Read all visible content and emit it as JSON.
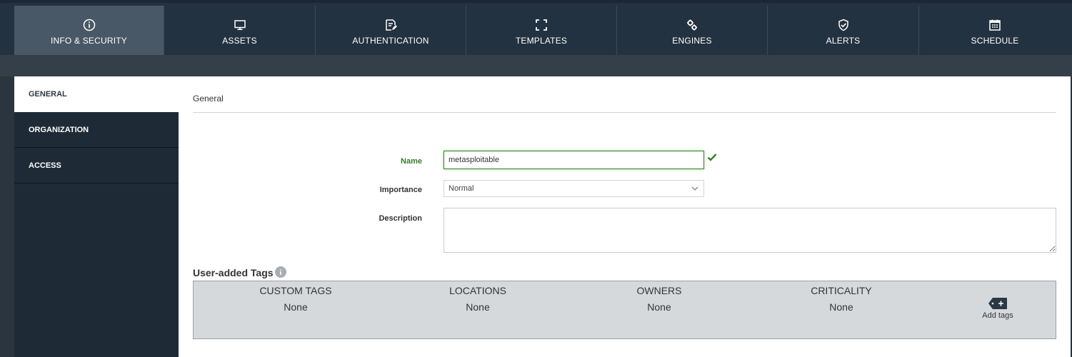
{
  "top_tabs": [
    {
      "label": "INFO & SECURITY",
      "icon": "info-icon",
      "active": true
    },
    {
      "label": "ASSETS",
      "icon": "monitor-icon",
      "active": false
    },
    {
      "label": "AUTHENTICATION",
      "icon": "edit-document-icon",
      "active": false
    },
    {
      "label": "TEMPLATES",
      "icon": "frame-icon",
      "active": false
    },
    {
      "label": "ENGINES",
      "icon": "gears-icon",
      "active": false
    },
    {
      "label": "ALERTS",
      "icon": "shield-check-icon",
      "active": false
    },
    {
      "label": "SCHEDULE",
      "icon": "calendar-icon",
      "active": false
    }
  ],
  "sidebar": {
    "items": [
      {
        "label": "GENERAL",
        "active": true
      },
      {
        "label": "ORGANIZATION",
        "active": false
      },
      {
        "label": "ACCESS",
        "active": false
      }
    ]
  },
  "general": {
    "section_title": "General",
    "name_label": "Name",
    "name_value": "metasploitable",
    "name_valid_icon": "checkmark-icon",
    "importance_label": "Importance",
    "importance_value": "Normal",
    "description_label": "Description",
    "description_value": ""
  },
  "tags": {
    "title": "User-added Tags",
    "columns": [
      {
        "header": "CUSTOM TAGS",
        "value": "None"
      },
      {
        "header": "LOCATIONS",
        "value": "None"
      },
      {
        "header": "OWNERS",
        "value": "None"
      },
      {
        "header": "CRITICALITY",
        "value": "None"
      }
    ],
    "add_label": "Add tags"
  },
  "colors": {
    "accent_valid": "#3a7a2e",
    "nav_bg": "#1e2b37",
    "topbar_bg": "#233240",
    "active_tab_bg": "#485866"
  }
}
